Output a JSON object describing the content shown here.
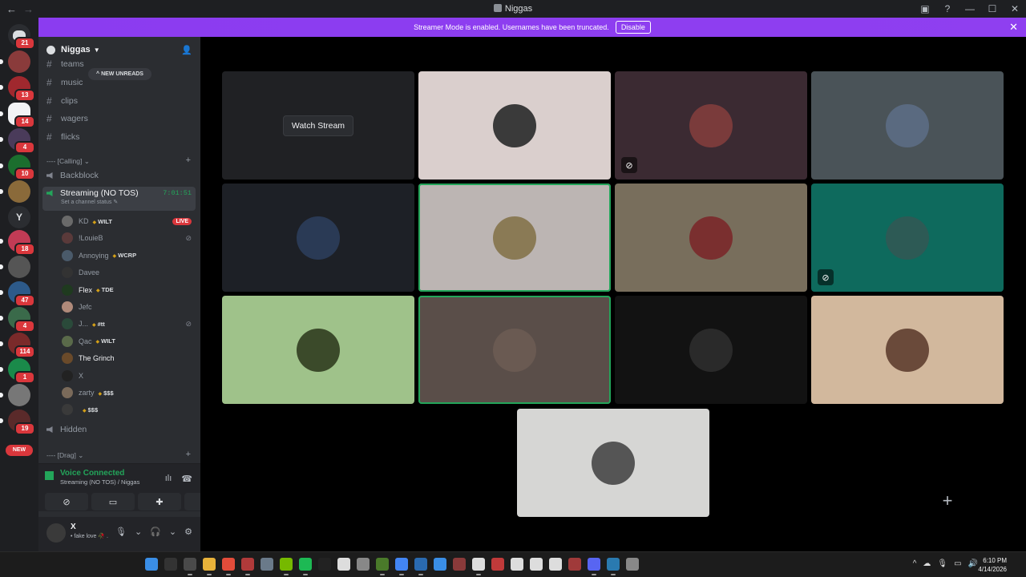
{
  "window": {
    "title": "Niggas"
  },
  "banner": {
    "text": "Streamer Mode is enabled. Usernames have been truncated.",
    "button": "Disable"
  },
  "server_rail": [
    {
      "badge": "21",
      "name": "home"
    },
    {
      "badge": "",
      "name": "server-1"
    },
    {
      "badge": "13",
      "name": "server-2"
    },
    {
      "badge": "14",
      "name": "server-3"
    },
    {
      "badge": "4",
      "name": "server-4"
    },
    {
      "badge": "10",
      "name": "server-5"
    },
    {
      "badge": "",
      "name": "server-6"
    },
    {
      "badge": "",
      "name": "server-y",
      "letter": "Y"
    },
    {
      "badge": "18",
      "name": "server-8"
    },
    {
      "badge": "",
      "name": "server-9"
    },
    {
      "badge": "47",
      "name": "server-10"
    },
    {
      "badge": "4",
      "name": "server-11"
    },
    {
      "badge": "114",
      "name": "server-12"
    },
    {
      "badge": "1",
      "name": "server-13"
    },
    {
      "badge": "",
      "name": "server-14"
    },
    {
      "badge": "19",
      "name": "server-15"
    }
  ],
  "server_rail_new": "NEW",
  "server": {
    "name": "Niggas"
  },
  "new_unreads": "NEW UNREADS",
  "text_channels": [
    "teams",
    "music",
    "clips",
    "wagers",
    "flicks"
  ],
  "categories": {
    "calling": "---- [Calling]",
    "drag": "---- [Drag]"
  },
  "voice_channels": {
    "backblock": "Backblock",
    "streaming": "Streaming (NO TOS)",
    "streaming_timer": "7:01:51",
    "streaming_status": "Set a channel status",
    "hidden": "Hidden"
  },
  "members": [
    {
      "name": "KD",
      "tag": "WILT",
      "live": "LIVE",
      "deaf": false,
      "bright": false
    },
    {
      "name": "!LouieB",
      "tag": "",
      "live": "",
      "deaf": true,
      "bright": false
    },
    {
      "name": "Annoying",
      "tag": "WCRP",
      "live": "",
      "deaf": false,
      "bright": false
    },
    {
      "name": "Davee",
      "tag": "",
      "live": "",
      "deaf": false,
      "bright": false
    },
    {
      "name": "Flex",
      "tag": "TDE",
      "live": "",
      "deaf": false,
      "bright": true
    },
    {
      "name": "Jefc",
      "tag": "",
      "live": "",
      "deaf": false,
      "bright": false
    },
    {
      "name": "J...",
      "tag": "#tt",
      "live": "",
      "deaf": true,
      "bright": false
    },
    {
      "name": "Qac",
      "tag": "WILT",
      "live": "",
      "deaf": false,
      "bright": false
    },
    {
      "name": "The Grinch",
      "tag": "",
      "live": "",
      "deaf": false,
      "bright": true
    },
    {
      "name": "X",
      "tag": "",
      "live": "",
      "deaf": false,
      "bright": false
    },
    {
      "name": "zarty",
      "tag": "$$$",
      "live": "",
      "deaf": false,
      "bright": false
    },
    {
      "name": "",
      "tag": "$$$",
      "live": "",
      "deaf": false,
      "bright": false
    }
  ],
  "voice_panel": {
    "status": "Voice Connected",
    "location": "Streaming (NO TOS) / Niggas"
  },
  "user_panel": {
    "name": "X",
    "status": "• fake love 🥀 ."
  },
  "stage": {
    "watch_stream": "Watch Stream",
    "tiles": [
      {
        "bg": "#202124",
        "watch": true
      },
      {
        "bg": "#dacfcd",
        "pic": "#3a3a3a"
      },
      {
        "bg": "#3b2a32",
        "pic": "#7a3b3b",
        "muted": true
      },
      {
        "bg": "#4a5358",
        "pic": "#5a6a80"
      },
      {
        "bg": "#1d2026",
        "pic": "#2a3a55"
      },
      {
        "bg": "#bcb5b3",
        "pic": "#8a7a55",
        "speaking": true
      },
      {
        "bg": "#786e5c",
        "pic": "#7a2f2f"
      },
      {
        "bg": "#0e6a5d",
        "pic": "#2d5a55",
        "muted": true
      },
      {
        "bg": "#9fc28a",
        "pic": "#3b4a2a"
      },
      {
        "bg": "#5a4e49",
        "pic": "#6a5a52",
        "speaking": true
      },
      {
        "bg": "#121212",
        "pic": "#2a2a2a"
      },
      {
        "bg": "#d2b89d",
        "pic": "#6a4a3a"
      },
      {
        "bg": "#d6d6d4",
        "pic": "#555555"
      }
    ]
  },
  "taskbar": {
    "time": "6:10 PM",
    "date": "4/14/2026"
  },
  "colors": {
    "accent": "#8b3cf0",
    "green": "#23a55a",
    "red": "#da373c"
  }
}
